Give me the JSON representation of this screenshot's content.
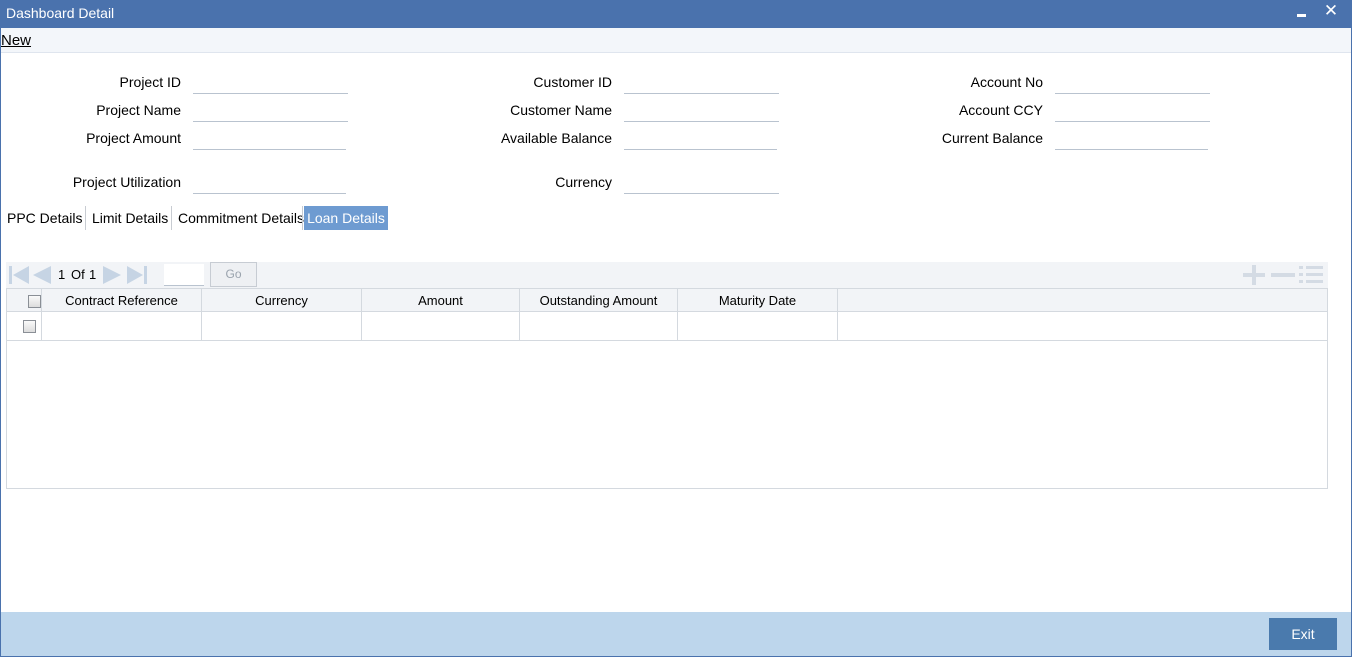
{
  "window": {
    "title": "Dashboard Detail"
  },
  "menu": {
    "new_label": "New"
  },
  "fields": {
    "project_id": {
      "label": "Project ID",
      "value": ""
    },
    "project_name": {
      "label": "Project Name",
      "value": ""
    },
    "project_amount": {
      "label": "Project Amount",
      "value": ""
    },
    "project_utilization": {
      "label": "Project Utilization",
      "value": ""
    },
    "customer_id": {
      "label": "Customer ID",
      "value": ""
    },
    "customer_name": {
      "label": "Customer Name",
      "value": ""
    },
    "available_balance": {
      "label": "Available Balance",
      "value": ""
    },
    "currency": {
      "label": "Currency",
      "value": ""
    },
    "account_no": {
      "label": "Account No",
      "value": ""
    },
    "account_ccy": {
      "label": "Account CCY",
      "value": ""
    },
    "current_balance": {
      "label": "Current Balance",
      "value": ""
    }
  },
  "tabs": [
    {
      "label": "PPC Details",
      "active": false
    },
    {
      "label": "Limit Details",
      "active": false
    },
    {
      "label": "Commitment Details",
      "active": false
    },
    {
      "label": "Loan Details",
      "active": true
    }
  ],
  "pager": {
    "current": "1",
    "of_label": "Of",
    "total": "1",
    "page_input": "",
    "go_label": "Go"
  },
  "grid": {
    "columns": [
      "Contract Reference",
      "Currency",
      "Amount",
      "Outstanding Amount",
      "Maturity Date"
    ],
    "rows": [
      [
        "",
        "",
        "",
        "",
        ""
      ]
    ]
  },
  "footer": {
    "exit_label": "Exit"
  },
  "colors": {
    "titlebar": "#4a72ad",
    "active_tab": "#6e9bd1",
    "footer": "#bdd6ec",
    "exit_button": "#4a7aad"
  }
}
